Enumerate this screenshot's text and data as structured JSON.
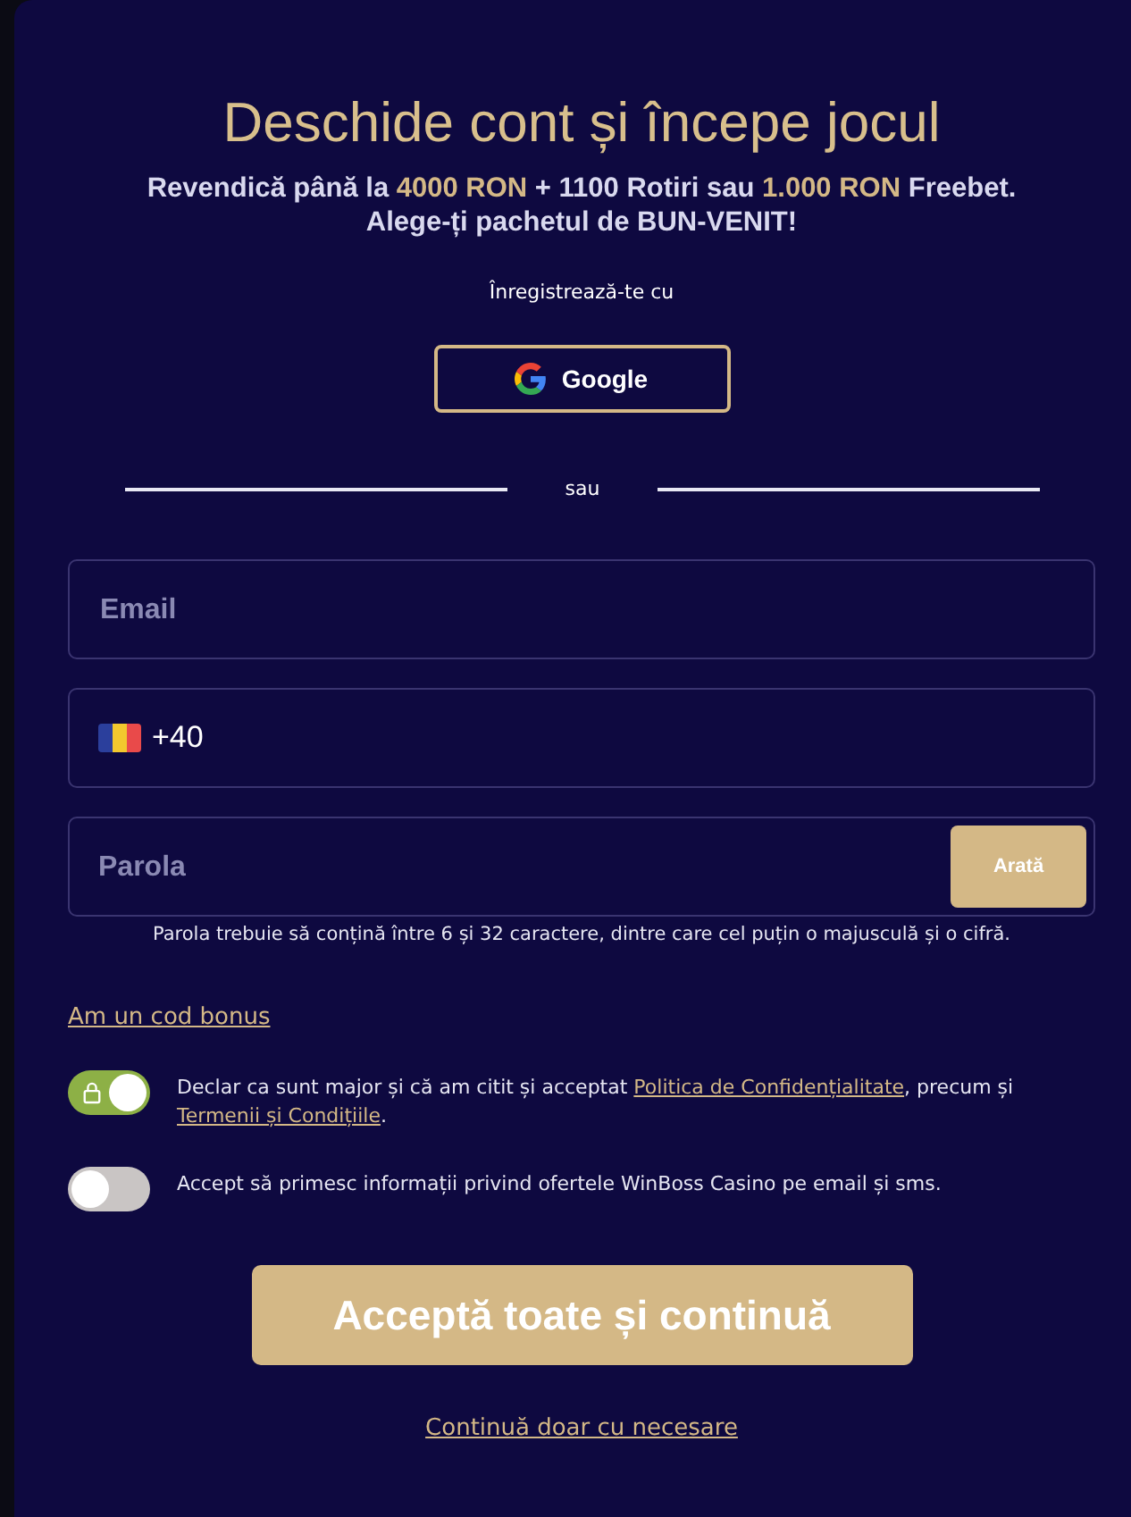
{
  "title": "Deschide cont și începe jocul",
  "subtitle_lines": [
    "Revendică până la **4000 RON** + 1100 Rotiri sau **1.000 RON** Freebet.",
    "Alege-ți pachetul de BUN-VENIT!"
  ],
  "register_with": "Înregistrează-te cu",
  "google_button": "Google",
  "divider": "sau",
  "fields": [
    {
      "kind": "text",
      "placeholder": "Email"
    },
    {
      "kind": "phone",
      "value": "+40"
    },
    {
      "kind": "password",
      "placeholder": "Parola",
      "action": "Arată"
    }
  ],
  "password_hint": "Parola trebuie să conțină între 6 și 32 caractere, dintre care cel puțin o majusculă și o cifră.",
  "bonus_link": "Am un cod bonus",
  "consents": [
    {
      "on": true,
      "locked": true,
      "parts": [
        {
          "kind": "text",
          "text": "Declar ca sunt major și că am citit și acceptat "
        },
        {
          "kind": "link",
          "text": "Politica de Confidențialitate"
        },
        {
          "kind": "text",
          "text": ", precum și "
        },
        {
          "kind": "link",
          "text": "Termenii și Condițiile"
        },
        {
          "kind": "text",
          "text": "."
        }
      ]
    },
    {
      "on": false,
      "locked": false,
      "parts": [
        {
          "kind": "text",
          "text": "Accept să primesc informații privind ofertele WinBoss Casino pe email și sms."
        }
      ]
    }
  ],
  "primary_button": "Acceptă toate și continuă",
  "secondary_link": "Continuă doar cu necesare"
}
